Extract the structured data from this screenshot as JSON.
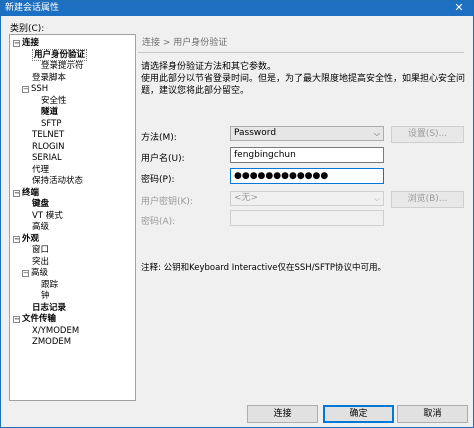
{
  "window": {
    "title": "新建会话属性",
    "close_glyph": "✕"
  },
  "sidebar": {
    "category_label": "类别(C):",
    "items": [
      {
        "label": "连接",
        "bold": true,
        "toggle": "−"
      },
      {
        "label": "用户身份验证",
        "bold": true,
        "selected": true
      },
      {
        "label": "登录提示符"
      },
      {
        "label": "登录脚本"
      },
      {
        "label": "SSH",
        "toggle": "−"
      },
      {
        "label": "安全性"
      },
      {
        "label": "隧道",
        "bold": true
      },
      {
        "label": "SFTP"
      },
      {
        "label": "TELNET"
      },
      {
        "label": "RLOGIN"
      },
      {
        "label": "SERIAL"
      },
      {
        "label": "代理"
      },
      {
        "label": "保持活动状态"
      },
      {
        "label": "终端",
        "bold": true,
        "toggle": "−"
      },
      {
        "label": "键盘",
        "bold": true
      },
      {
        "label": "VT 模式"
      },
      {
        "label": "高级"
      },
      {
        "label": "外观",
        "bold": true,
        "toggle": "−"
      },
      {
        "label": "窗口"
      },
      {
        "label": "突出"
      },
      {
        "label": "高级",
        "toggle": "−"
      },
      {
        "label": "跟踪"
      },
      {
        "label": "钟"
      },
      {
        "label": "日志记录",
        "bold": true
      },
      {
        "label": "文件传输",
        "bold": true,
        "toggle": "−"
      },
      {
        "label": "X/YMODEM"
      },
      {
        "label": "ZMODEM"
      }
    ]
  },
  "panel": {
    "breadcrumb": "连接 > 用户身份验证",
    "description_1": "请选择身份验证方法和其它参数。",
    "description_2": "使用此部分以节省登录时间。但是，为了最大限度地提高安全性，如果担心安全问题，建议您将此部分留空。",
    "method_label": "方法(M):",
    "method_value": "Password",
    "settings_button": "设置(S)...",
    "username_label": "用户名(U):",
    "username_value": "fengbingchun",
    "password_label": "密码(P):",
    "password_value": "●●●●●●●●●●●●",
    "user_key_label": "用户密钥(K):",
    "user_key_value": "<无>",
    "browse_button": "浏览(B)...",
    "passphrase_label": "密码(A):",
    "passphrase_value": "",
    "note": "注释: 公钥和Keyboard Interactive仅在SSH/SFTP协议中可用。"
  },
  "footer": {
    "connect_button": "连接",
    "ok_button": "确定",
    "cancel_button": "取消"
  }
}
